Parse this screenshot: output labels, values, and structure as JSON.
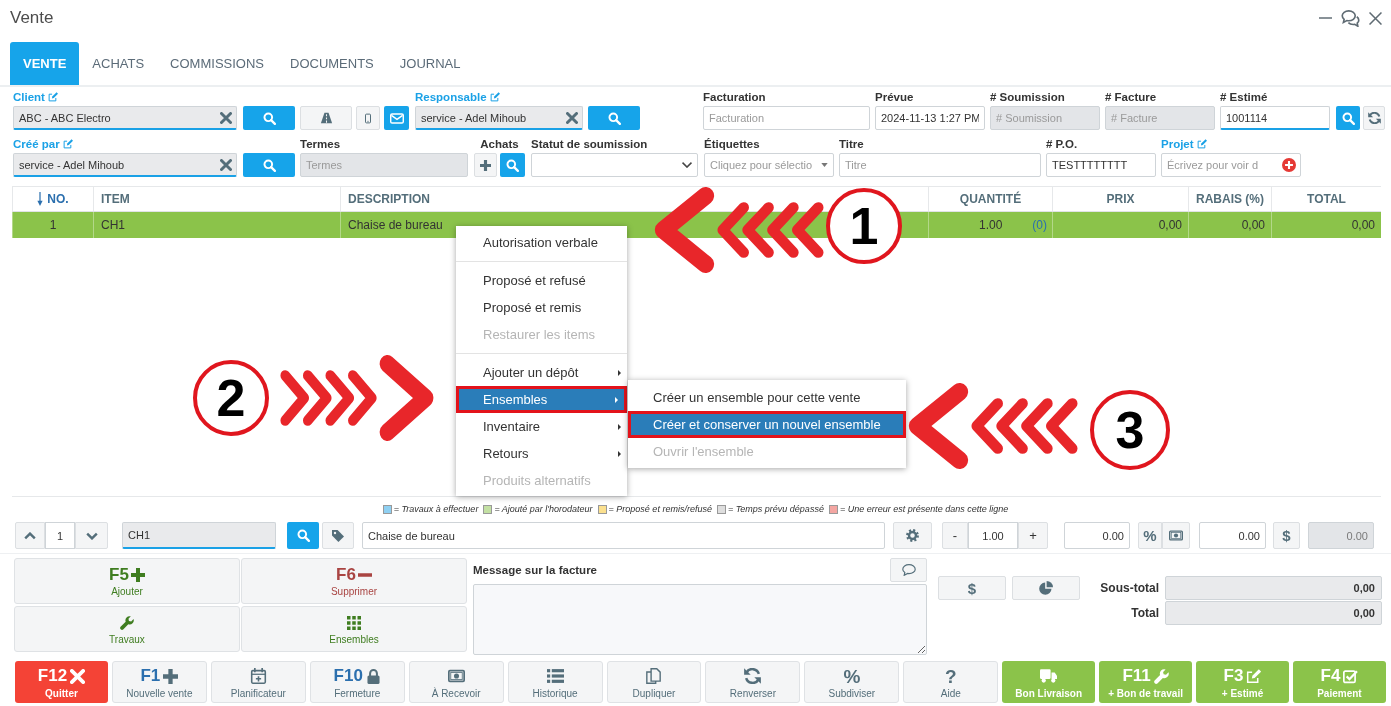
{
  "window": {
    "title": "Vente"
  },
  "tabs": [
    {
      "label": "VENTE",
      "selected": true
    },
    {
      "label": "ACHATS",
      "selected": false
    },
    {
      "label": "COMMISSIONS",
      "selected": false
    },
    {
      "label": "DOCUMENTS",
      "selected": false
    },
    {
      "label": "JOURNAL",
      "selected": false
    }
  ],
  "client": {
    "label": "Client",
    "value": "ABC - ABC Electro"
  },
  "responsable": {
    "label": "Responsable",
    "value": "service - Adel Mihoub"
  },
  "billing": {
    "label": "Facturation",
    "placeholder": "Facturation",
    "disabled": false
  },
  "planned": {
    "label": "Prévue",
    "value": "2024-11-13 1:27 PM",
    "disabled": false
  },
  "quote_number": {
    "label": "# Soumission",
    "placeholder": "# Soumission",
    "disabled": true
  },
  "invoice_number": {
    "label": "# Facture",
    "placeholder": "# Facture",
    "disabled": true
  },
  "estimate_number": {
    "label": "# Estimé",
    "value": "1001114",
    "disabled": false
  },
  "created_by": {
    "label": "Créé par",
    "value": "service - Adel Mihoub"
  },
  "terms": {
    "label": "Termes",
    "placeholder": "Termes",
    "disabled": true
  },
  "purchases": {
    "label": "Achats"
  },
  "quote_status": {
    "label": "Statut de soumission"
  },
  "tags": {
    "label": "Étiquettes",
    "placeholder": "Cliquez pour sélectio"
  },
  "title_field": {
    "label": "Titre",
    "placeholder": "Titre",
    "disabled": false
  },
  "po_number": {
    "label": "# P.O.",
    "value": "TESTTTTTTTT",
    "disabled": false
  },
  "project": {
    "label": "Projet",
    "placeholder": "Écrivez pour voir d"
  },
  "table": {
    "columns": [
      {
        "label": "NO.",
        "sorted": true
      },
      {
        "label": "ITEM",
        "sorted": false
      },
      {
        "label": "DESCRIPTION",
        "sorted": false
      },
      {
        "label": "QUANTITÉ",
        "sorted": false
      },
      {
        "label": "PRIX",
        "sorted": false
      },
      {
        "label": "RABAIS (%)",
        "sorted": false
      },
      {
        "label": "TOTAL",
        "sorted": false
      }
    ],
    "rows": [
      {
        "no": "1",
        "item": "CH1",
        "description": "Chaise de bureau",
        "quantity": "1.00",
        "stock": "(0)",
        "price": "0,00",
        "discount": "0,00",
        "total": "0,00",
        "selected": true
      }
    ]
  },
  "context_menu": {
    "groups": [
      {
        "items": [
          {
            "label": "Autorisation verbale",
            "disabled": false,
            "has_submenu": false,
            "selected": false,
            "outlined": false
          }
        ]
      },
      {
        "items": [
          {
            "label": "Proposé et refusé",
            "disabled": false,
            "has_submenu": false,
            "selected": false,
            "outlined": false
          },
          {
            "label": "Proposé et remis",
            "disabled": false,
            "has_submenu": false,
            "selected": false,
            "outlined": false
          },
          {
            "label": "Restaurer les items",
            "disabled": true,
            "has_submenu": false,
            "selected": false,
            "outlined": false
          }
        ]
      },
      {
        "items": [
          {
            "label": "Ajouter un dépôt",
            "disabled": false,
            "has_submenu": true,
            "selected": false,
            "outlined": false
          },
          {
            "label": "Ensembles",
            "disabled": false,
            "has_submenu": true,
            "selected": true,
            "outlined": true
          },
          {
            "label": "Inventaire",
            "disabled": false,
            "has_submenu": true,
            "selected": false,
            "outlined": false
          },
          {
            "label": "Retours",
            "disabled": false,
            "has_submenu": true,
            "selected": false,
            "outlined": false
          },
          {
            "label": "Produits alternatifs",
            "disabled": true,
            "has_submenu": false,
            "selected": false,
            "outlined": false
          }
        ]
      }
    ],
    "submenu": {
      "items": [
        {
          "label": "Créer un ensemble pour cette vente",
          "disabled": false,
          "selected": false,
          "outlined": false
        },
        {
          "label": "Créer et conserver un nouvel ensemble",
          "disabled": false,
          "selected": true,
          "outlined": true
        },
        {
          "label": "Ouvrir l'ensemble",
          "disabled": true,
          "selected": false,
          "outlined": false
        }
      ]
    }
  },
  "legend": [
    {
      "color": "#8fd0f2",
      "label": "= Travaux à effectuer"
    },
    {
      "color": "#c3e0a3",
      "label": "= Ajouté par l'horodateur"
    },
    {
      "color": "#fbe08e",
      "label": "= Proposé et remis/refusé"
    },
    {
      "color": "#dedede",
      "label": "= Temps prévu dépassé"
    },
    {
      "color": "#f4a6a2",
      "label": "= Une erreur est présente dans cette ligne"
    }
  ],
  "line_editor": {
    "line_number": "1",
    "item": "CH1",
    "description": "Chaise de bureau",
    "minus": "-",
    "quantity": "1.00",
    "plus": "+",
    "percent": "%",
    "dollar": "$",
    "amounts": [
      {
        "value": "0.00",
        "disabled": false
      },
      {
        "value": "0.00",
        "disabled": false
      },
      {
        "value": "0.00",
        "disabled": true
      }
    ]
  },
  "actions": [
    {
      "key": "F5",
      "label": "Ajouter",
      "kind": "add"
    },
    {
      "key": "F6",
      "label": "Supprimer",
      "kind": "remove"
    },
    {
      "label": "Travaux",
      "kind": "work"
    },
    {
      "label": "Ensembles",
      "kind": "sets"
    }
  ],
  "message": {
    "label": "Message sur la facture"
  },
  "totals": {
    "dollar": "$",
    "rows": [
      {
        "label": "Sous-total",
        "value": "0,00"
      },
      {
        "label": "Total",
        "value": "0,00"
      }
    ]
  },
  "toolbar": [
    {
      "key": "F12",
      "label": "Quitter",
      "kind": "danger"
    },
    {
      "key": "F1",
      "label": "Nouvelle vente",
      "kind": "default"
    },
    {
      "label": "Planificateur",
      "kind": "default"
    },
    {
      "key": "F10",
      "label": "Fermeture",
      "kind": "default"
    },
    {
      "label": "À Recevoir",
      "kind": "default"
    },
    {
      "label": "Historique",
      "kind": "default"
    },
    {
      "label": "Dupliquer",
      "kind": "default"
    },
    {
      "label": "Renverser",
      "kind": "default"
    },
    {
      "symbol": "%",
      "label": "Subdiviser",
      "kind": "default"
    },
    {
      "symbol": "?",
      "label": "Aide",
      "kind": "default"
    },
    {
      "label": "Bon Livraison",
      "kind": "success"
    },
    {
      "key": "F11",
      "label": "+ Bon de travail",
      "kind": "success"
    },
    {
      "key": "F3",
      "label": "+ Estimé",
      "kind": "success"
    },
    {
      "key": "F4",
      "label": "Paiement",
      "kind": "success"
    }
  ],
  "annotations": [
    {
      "number": "1",
      "kind": "left"
    },
    {
      "number": "2",
      "kind": "right"
    },
    {
      "number": "3",
      "kind": "left"
    }
  ]
}
